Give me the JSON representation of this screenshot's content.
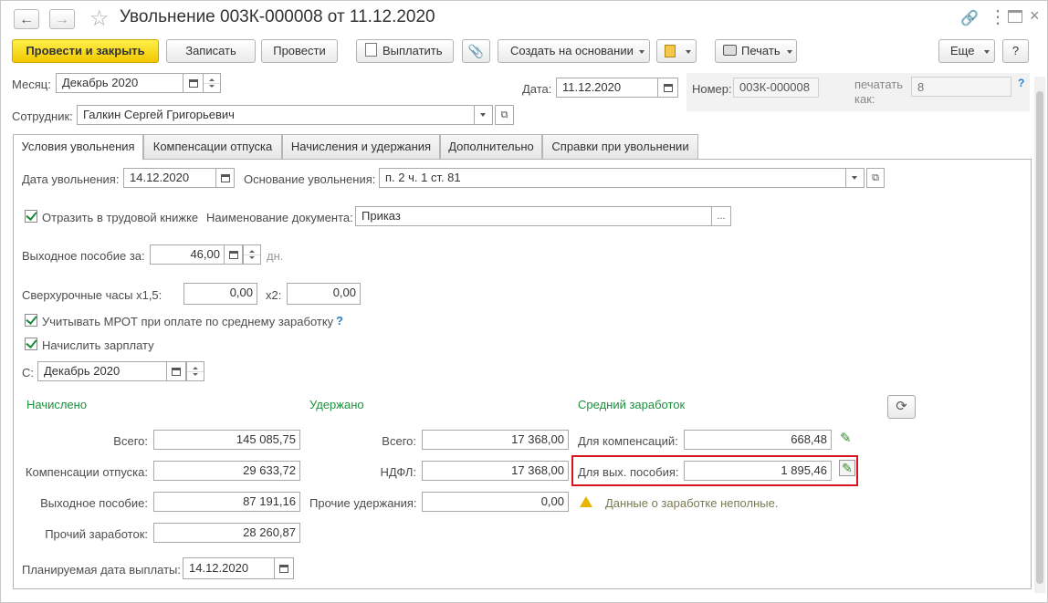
{
  "window": {
    "title": "Увольнение 003К-000008 от 11.12.2020"
  },
  "toolbar": {
    "post_close": "Провести и закрыть",
    "save": "Записать",
    "post": "Провести",
    "pay": "Выплатить",
    "create_based": "Создать на основании",
    "print": "Печать",
    "more": "Еще",
    "help": "?"
  },
  "header": {
    "month_label": "Месяц:",
    "month_value": "Декабрь 2020",
    "date_label": "Дата:",
    "date_value": "11.12.2020",
    "number_label": "Номер:",
    "number_value": "003К-000008",
    "print_as_label_1": "печатать",
    "print_as_label_2": "как:",
    "print_as_placeholder": "8",
    "employee_label": "Сотрудник:",
    "employee_value": "Галкин Сергей Григорьевич"
  },
  "tabs": [
    {
      "label": "Условия увольнения"
    },
    {
      "label": "Компенсации отпуска"
    },
    {
      "label": "Начисления и удержания"
    },
    {
      "label": "Дополнительно"
    },
    {
      "label": "Справки при увольнении"
    }
  ],
  "conditions": {
    "dismissal_date_label": "Дата увольнения:",
    "dismissal_date_value": "14.12.2020",
    "reason_label": "Основание увольнения:",
    "reason_value": "п. 2 ч. 1 ст. 81",
    "workbook_label": "Отразить в трудовой книжке",
    "doc_name_label": "Наименование документа:",
    "doc_name_value": "Приказ",
    "ellipsis": "...",
    "severance_label": "Выходное пособие за:",
    "severance_value": "46,00",
    "severance_unit": "дн.",
    "overtime_label": "Сверхурочные часы х1,5:",
    "overtime_15_value": "0,00",
    "overtime_x2_label": "х2:",
    "overtime_x2_value": "0,00",
    "mrot_label": "Учитывать МРОТ при оплате по среднему заработку",
    "mrot_help": "?",
    "accrue_label": "Начислить зарплату",
    "from_label": "С:",
    "from_value": "Декабрь 2020"
  },
  "accrued": {
    "title": "Начислено",
    "rows": [
      {
        "label": "Всего:",
        "value": "145 085,75"
      },
      {
        "label": "Компенсации отпуска:",
        "value": "29 633,72"
      },
      {
        "label": "Выходное пособие:",
        "value": "87 191,16"
      },
      {
        "label": "Прочий заработок:",
        "value": "28 260,87"
      }
    ]
  },
  "withheld": {
    "title": "Удержано",
    "rows": [
      {
        "label": "Всего:",
        "value": "17 368,00"
      },
      {
        "label": "НДФЛ:",
        "value": "17 368,00"
      },
      {
        "label": "Прочие удержания:",
        "value": "0,00"
      }
    ]
  },
  "average": {
    "title": "Средний заработок",
    "rows": [
      {
        "label": "Для компенсаций:",
        "value": "668,48"
      },
      {
        "label": "Для вых. пособия:",
        "value": "1 895,46"
      }
    ],
    "warning": "Данные о заработке неполные."
  },
  "payment": {
    "label": "Планируемая дата выплаты:",
    "value": "14.12.2020"
  },
  "colors": {
    "primary_button": "#f5d313",
    "section_title": "#1f8f3f",
    "highlight_box": "#d9141e",
    "help": "#2d7fc6"
  }
}
